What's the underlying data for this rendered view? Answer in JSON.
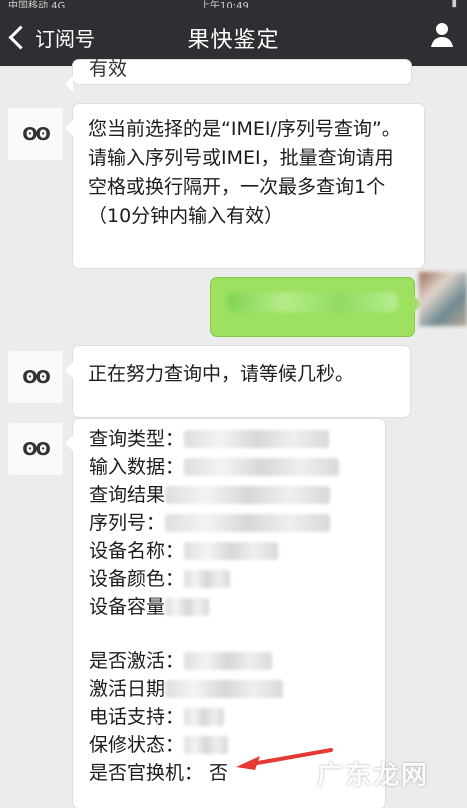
{
  "status": {
    "left_text": "中国移动 4G",
    "center_text": "上午10:49"
  },
  "nav": {
    "back_label": "订阅号",
    "title": "果快鉴定"
  },
  "messages": {
    "top_partial": "有效",
    "instruction": "您当前选择的是“IMEI/序列号查询”。请输入序列号或IMEI，批量查询请用空格或换行隔开，一次最多查询1个（10分钟内输入有效）",
    "loading": "正在努力查询中，请等候几秒。"
  },
  "result": {
    "items": [
      {
        "label": "查询类型："
      },
      {
        "label": "输入数据："
      },
      {
        "label": "查询结果"
      },
      {
        "label": "序列号："
      },
      {
        "label": "设备名称："
      },
      {
        "label": "设备颜色："
      },
      {
        "label": "设备容量"
      },
      {
        "label": "是否激活："
      },
      {
        "label": "激活日期"
      },
      {
        "label": "电话支持："
      },
      {
        "label": "保修状态："
      },
      {
        "label": "是否官换机：",
        "value": "否"
      }
    ]
  },
  "colors": {
    "navbar": "#2f2f33",
    "chat_bg": "#ececec",
    "bubble_green": "#9ee060",
    "arrow_red": "#e53935"
  },
  "icons": {
    "avatar": "eyes-icon",
    "profile": "person-icon",
    "back": "chevron-left-icon",
    "arrow": "red-arrow-icon"
  },
  "watermark": "广东龙网"
}
